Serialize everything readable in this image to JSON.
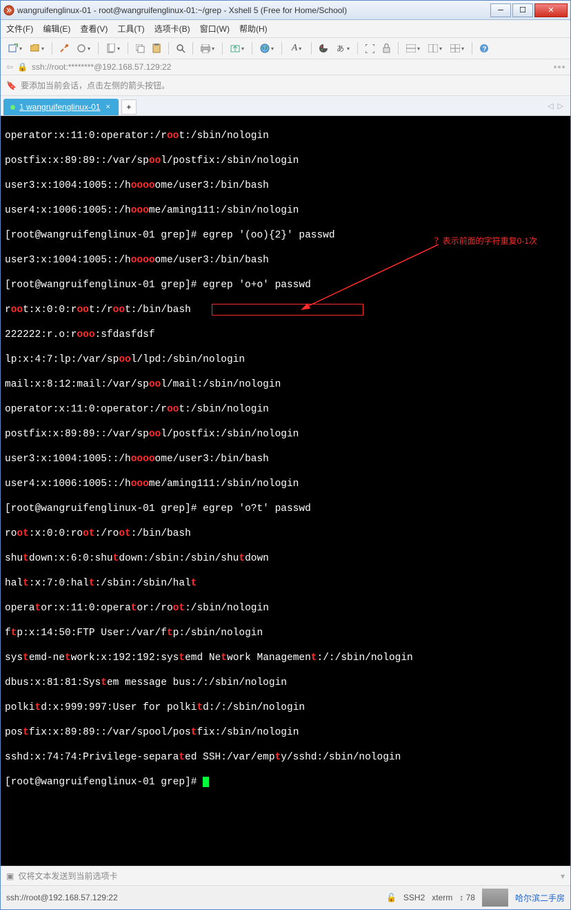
{
  "window": {
    "title": "wangruifenglinux-01 - root@wangruifenglinux-01:~/grep - Xshell 5 (Free for Home/School)"
  },
  "menu": {
    "file": "文件(F)",
    "edit": "编辑(E)",
    "view": "查看(V)",
    "tools": "工具(T)",
    "tabs": "选项卡(B)",
    "window": "窗口(W)",
    "help": "帮助(H)"
  },
  "address": {
    "text": "ssh://root:********@192.168.57.129:22"
  },
  "infobar": {
    "text": "要添加当前会话，点击左侧的箭头按钮。"
  },
  "tab": {
    "label": "1 wangruifenglinux-01"
  },
  "annotation": "？表示前面的字符重复0-1次",
  "terminal": {
    "l1_a": "operator:x:11:0:operator:/r",
    "l1_b": "oo",
    "l1_c": "t:/sbin/nologin",
    "l2_a": "postfix:x:89:89::/var/sp",
    "l2_b": "oo",
    "l2_c": "l/postfix:/sbin/nologin",
    "l3_a": "user3:x:1004:1005::/h",
    "l3_b": "oooo",
    "l3_c": "ome/user3:/bin/bash",
    "l4_a": "user4:x:1006:1005::/h",
    "l4_b": "ooo",
    "l4_c": "me/aming111:/sbin/nologin",
    "l5": "[root@wangruifenglinux-01 grep]# egrep '(oo){2}' passwd",
    "l6_a": "user3:x:1004:1005::/h",
    "l6_b": "oooo",
    "l6_c": "ome/user3:/bin/bash",
    "l7": "[root@wangruifenglinux-01 grep]# egrep 'o+o' passwd",
    "l8_a": "r",
    "l8_b": "oo",
    "l8_c": "t:x:0:0:r",
    "l8_d": "oo",
    "l8_e": "t:/r",
    "l8_f": "oo",
    "l8_g": "t:/bin/bash",
    "l9_a": "222222:r.o:r",
    "l9_b": "ooo",
    "l9_c": ":sfdasfdsf",
    "l10_a": "lp:x:4:7:lp:/var/sp",
    "l10_b": "oo",
    "l10_c": "l/lpd:/sbin/nologin",
    "l11_a": "mail:x:8:12:mail:/var/sp",
    "l11_b": "oo",
    "l11_c": "l/mail:/sbin/nologin",
    "l12_a": "operator:x:11:0:operator:/r",
    "l12_b": "oo",
    "l12_c": "t:/sbin/nologin",
    "l13_a": "postfix:x:89:89::/var/sp",
    "l13_b": "oo",
    "l13_c": "l/postfix:/sbin/nologin",
    "l14_a": "user3:x:1004:1005::/h",
    "l14_b": "oooo",
    "l14_c": "ome/user3:/bin/bash",
    "l15_a": "user4:x:1006:1005::/h",
    "l15_b": "ooo",
    "l15_c": "me/aming111:/sbin/nologin",
    "l16_a": "[root@wangruifenglinux-01 grep]# ",
    "l16_b": "egrep 'o?t' passwd",
    "l17_a": "ro",
    "l17_b": "ot",
    "l17_c": ":x:0:0:ro",
    "l17_d": "ot",
    "l17_e": ":/ro",
    "l17_f": "ot",
    "l17_g": ":/bin/bash",
    "l18_a": "shu",
    "l18_b": "t",
    "l18_c": "down:x:6:0:shu",
    "l18_d": "t",
    "l18_e": "down:/sbin:/sbin/shu",
    "l18_f": "t",
    "l18_g": "down",
    "l19_a": "hal",
    "l19_b": "t",
    "l19_c": ":x:7:0:hal",
    "l19_d": "t",
    "l19_e": ":/sbin:/sbin/hal",
    "l19_f": "t",
    "l20_a": "opera",
    "l20_b": "t",
    "l20_c": "or:x:11:0:opera",
    "l20_d": "t",
    "l20_e": "or:/ro",
    "l20_f": "ot",
    "l20_g": ":/sbin/nologin",
    "l21_a": "f",
    "l21_b": "t",
    "l21_c": "p:x:14:50:FTP User:/var/f",
    "l21_d": "t",
    "l21_e": "p:/sbin/nologin",
    "l22_a": "sys",
    "l22_b": "t",
    "l22_c": "emd-ne",
    "l22_d": "t",
    "l22_e": "work:x:192:192:sys",
    "l22_f": "t",
    "l22_g": "emd Ne",
    "l22_h": "t",
    "l22_i": "work Managemen",
    "l22_j": "t",
    "l22_k": ":/:/sbin/nologin",
    "l23_a": "dbus:x:81:81:Sys",
    "l23_b": "t",
    "l23_c": "em message bus:/:/sbin/nologin",
    "l24_a": "polki",
    "l24_b": "t",
    "l24_c": "d:x:999:997:User for polki",
    "l24_d": "t",
    "l24_e": "d:/:/sbin/nologin",
    "l25_a": "pos",
    "l25_b": "t",
    "l25_c": "fix:x:89:89::/var/spool/pos",
    "l25_d": "t",
    "l25_e": "fix:/sbin/nologin",
    "l26_a": "sshd:x:74:74:Privilege-separa",
    "l26_b": "t",
    "l26_c": "ed SSH:/var/emp",
    "l26_d": "t",
    "l26_e": "y/sshd:/sbin/nologin",
    "l27": "[root@wangruifenglinux-01 grep]# "
  },
  "bottom": {
    "hint": "仅将文本发送到当前选项卡"
  },
  "status": {
    "conn": "ssh://root@192.168.57.129:22",
    "ssh": "SSH2",
    "term": "xterm",
    "size": "78",
    "ad": "哈尔滨二手房"
  }
}
